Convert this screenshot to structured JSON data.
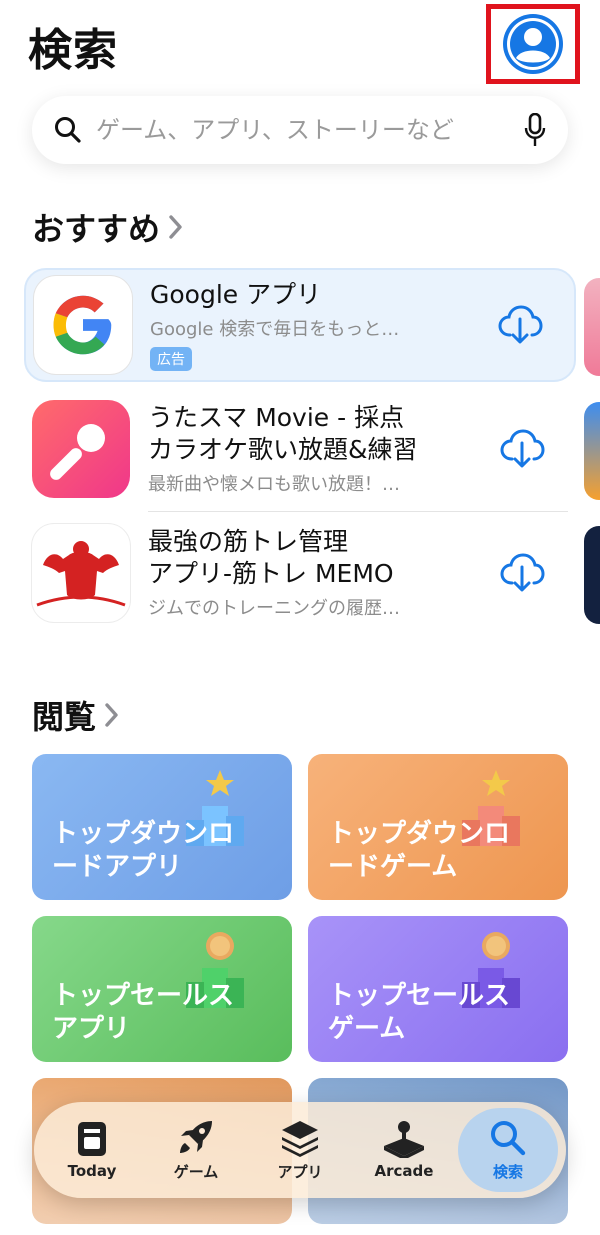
{
  "header": {
    "title": "検索"
  },
  "search": {
    "placeholder": "ゲーム、アプリ、ストーリーなど"
  },
  "recommended": {
    "heading": "おすすめ",
    "apps": [
      {
        "name": "Google アプリ",
        "subtitle": "Google 検索で毎日をもっと…",
        "badge": "広告"
      },
      {
        "name": "うたスマ Movie - 採点",
        "name2": "カラオケ歌い放題&練習",
        "subtitle": "最新曲や懐メロも歌い放題！…"
      },
      {
        "name": "最強の筋トレ管理",
        "name2": "アプリ-筋トレ MEMO",
        "subtitle": "ジムでのトレーニングの履歴…"
      }
    ]
  },
  "browse": {
    "heading": "閲覧",
    "tiles": [
      {
        "label": "トップダウンロードアプリ",
        "color": "#7aa8e8"
      },
      {
        "label": "トップダウンロードゲーム",
        "color": "#f2a25e"
      },
      {
        "label": "トップセールスアプリ",
        "color": "#6ccb6a"
      },
      {
        "label": "トップセールスゲーム",
        "color": "#9a7ef5"
      }
    ]
  },
  "tabbar": {
    "tabs": [
      {
        "label": "Today",
        "icon": "today-icon"
      },
      {
        "label": "ゲーム",
        "icon": "rocket-icon"
      },
      {
        "label": "アプリ",
        "icon": "apps-stack-icon"
      },
      {
        "label": "Arcade",
        "icon": "joystick-icon"
      },
      {
        "label": "検索",
        "icon": "search-icon"
      }
    ],
    "active": "検索"
  },
  "colors": {
    "accent": "#1677e4",
    "highlight_border": "#e0131d"
  }
}
